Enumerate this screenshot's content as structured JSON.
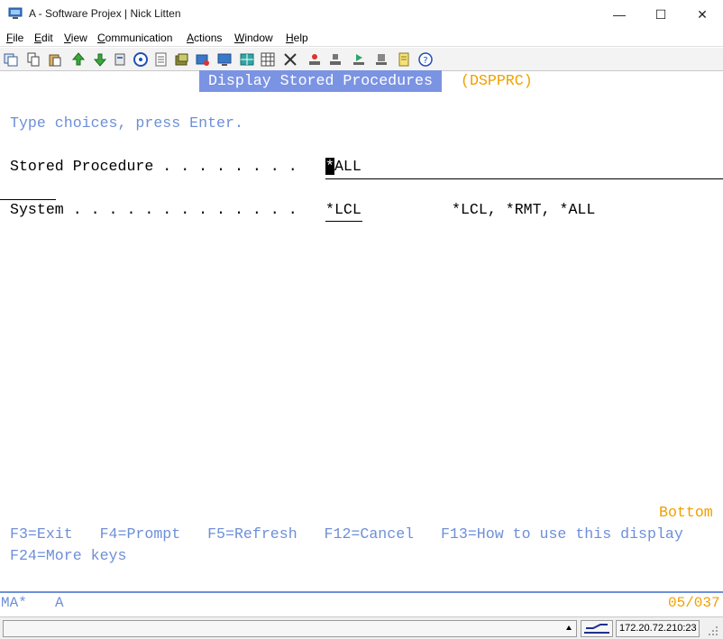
{
  "window": {
    "title": "A - Software Projex | Nick Litten",
    "minimize_glyph": "—",
    "maximize_glyph": "☐",
    "close_glyph": "✕"
  },
  "menu": {
    "items": [
      {
        "label": "File",
        "mnemonic": "F",
        "rest": "ile"
      },
      {
        "label": "Edit",
        "mnemonic": "E",
        "rest": "dit"
      },
      {
        "label": "View",
        "mnemonic": "V",
        "rest": "iew"
      },
      {
        "label": "Communication",
        "mnemonic": "C",
        "rest": "ommunication"
      },
      {
        "label": "Actions",
        "mnemonic": "A",
        "rest": "ctions"
      },
      {
        "label": "Window",
        "mnemonic": "W",
        "rest": "indow"
      },
      {
        "label": "Help",
        "mnemonic": "H",
        "rest": "elp"
      }
    ]
  },
  "toolbar": {
    "icons": [
      "copy-screen-icon",
      "copy-icon",
      "paste-icon",
      "send-file-icon",
      "receive-file-icon",
      "print-icon",
      "help-circle-icon",
      "notes-icon",
      "macro-icon",
      "record-icon",
      "display-icon",
      "grid-icon",
      "tools-icon",
      "stop-icon",
      "play-icon",
      "run-icon",
      "step-icon",
      "quick-edit-icon",
      "info-icon"
    ]
  },
  "screen": {
    "panel_title": "Display Stored Procedures",
    "command": "(DSPPRC)",
    "instruction": "Type choices, press Enter.",
    "fields": [
      {
        "label": "Stored Procedure . . . . . . . .",
        "value_cursor": "*",
        "value_rest": "ALL"
      },
      {
        "label": "System . . . . . . . . . . . . .",
        "value": "*LCL",
        "choices": "*LCL, *RMT, *ALL"
      }
    ],
    "more_indicator": "Bottom",
    "function_keys_line1": "F3=Exit   F4=Prompt   F5=Refresh   F12=Cancel   F13=How to use this display",
    "function_keys_line2": "F24=More keys"
  },
  "oia": {
    "session_indicator": "MA*",
    "session_letter": "A",
    "cursor_position": "05/037"
  },
  "statusbar": {
    "connection": "172.20.72.210:23"
  },
  "colors": {
    "panel_title_bg": "#7b93e3",
    "command_text": "#f0a000",
    "prompt_text": "#6e8fd8"
  }
}
